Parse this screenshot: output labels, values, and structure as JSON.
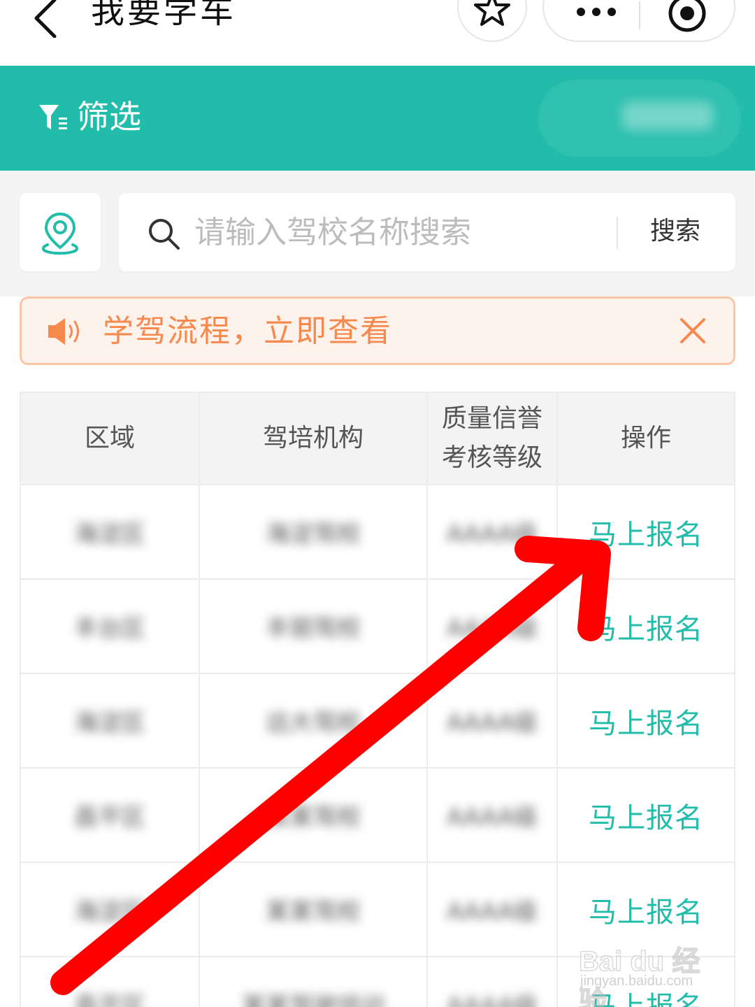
{
  "navbar": {
    "title": "我要学车"
  },
  "filter": {
    "label": "筛选"
  },
  "search": {
    "placeholder": "请输入驾校名称搜索",
    "button_label": "搜索"
  },
  "notice": {
    "text": "学驾流程，立即查看"
  },
  "table": {
    "headers": [
      "区域",
      "驾培机构",
      "质量信誉\n考核等级",
      "操作"
    ],
    "rows": [
      {
        "region": "海淀区",
        "school": "海淀驾校",
        "grade": "AAAA级",
        "action": "马上报名"
      },
      {
        "region": "丰台区",
        "school": "丰丽驾校",
        "grade": "AAAA级",
        "action": "马上报名"
      },
      {
        "region": "海淀区",
        "school": "远大驾校",
        "grade": "AAAA级",
        "action": "马上报名"
      },
      {
        "region": "昌平区",
        "school": "某某驾校",
        "grade": "AAAA级",
        "action": "马上报名"
      },
      {
        "region": "海淀区",
        "school": "某某驾校",
        "grade": "AAAA级",
        "action": "马上报名"
      },
      {
        "region": "昌平区",
        "school": "某某驾驶培训",
        "grade": "AAAA级",
        "action": "马上报名"
      }
    ]
  },
  "colors": {
    "accent": "#22bdaa",
    "notice_text": "#f7894d",
    "notice_border": "#fbc6a6",
    "arrow": "#ff0000"
  },
  "icons": [
    "back-arrow-icon",
    "star-icon",
    "more-dots-icon",
    "close-circle-icon",
    "filter-icon",
    "location-pin-icon",
    "search-icon",
    "speaker-icon",
    "close-icon"
  ],
  "watermark": {
    "main": "Bai du 经验",
    "sub": "jingyan.baidu.com"
  }
}
